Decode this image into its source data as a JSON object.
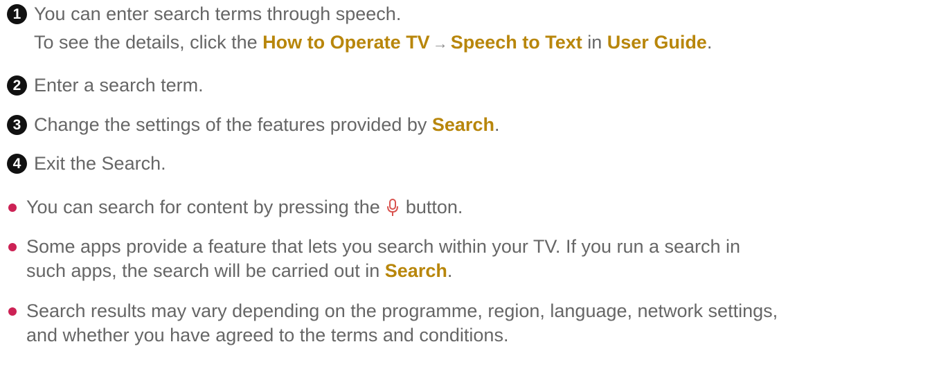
{
  "numbered": [
    {
      "num": "1",
      "line1": "You can enter search terms through speech.",
      "line2_pre": "To see the details, click the ",
      "link1": "How to Operate TV",
      "arrow": "→",
      "link2": "Speech to Text",
      "mid": " in ",
      "link3": "User Guide",
      "end": "."
    },
    {
      "num": "2",
      "text": "Enter a search term."
    },
    {
      "num": "3",
      "pre": "Change the settings of the features provided by ",
      "highlight": "Search",
      "post": "."
    },
    {
      "num": "4",
      "text": "Exit the Search."
    }
  ],
  "bullets": [
    {
      "pre": "You can search for content by pressing the ",
      "icon": "microphone-icon",
      "post": " button."
    },
    {
      "line1": "Some apps provide a feature that lets you search within your TV. If you run a search in",
      "line2_pre": "such apps, the search will be carried out in ",
      "highlight": "Search",
      "post": "."
    },
    {
      "line1": "Search results may vary depending on the programme, region, language, network settings,",
      "line2": "and whether you have agreed to the terms and conditions."
    }
  ],
  "colors": {
    "highlight": "#b8860b",
    "body_text": "#666666",
    "bullet_dot": "#cc2255",
    "badge": "#111111"
  }
}
